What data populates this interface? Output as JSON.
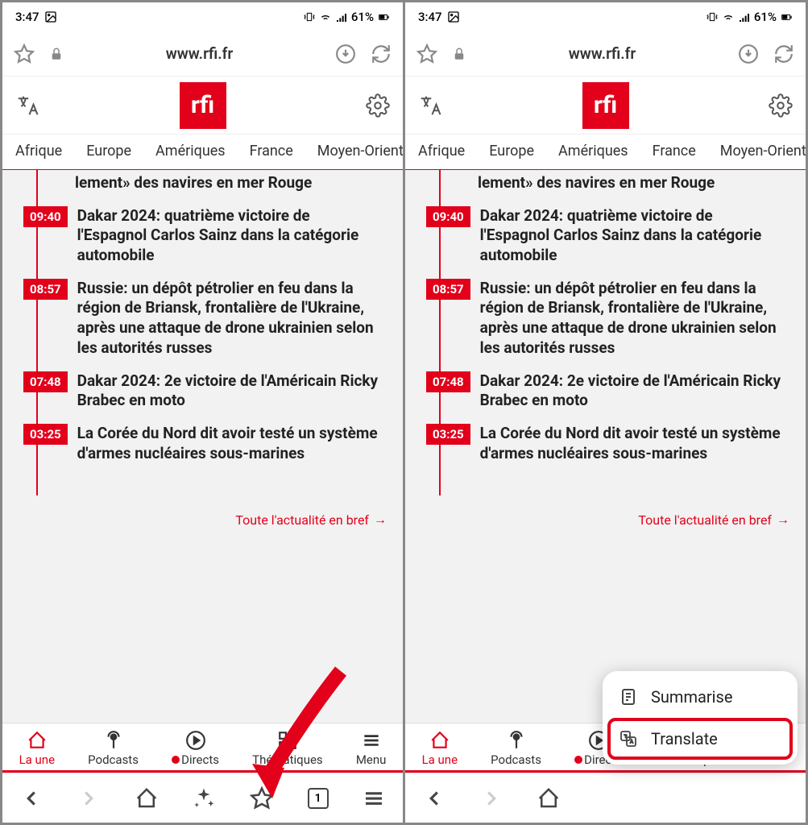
{
  "status": {
    "time": "3:47",
    "battery": "61%"
  },
  "browser": {
    "url": "www.rfi.fr",
    "tabs_count": "1"
  },
  "site": {
    "logo_text": "rfi",
    "nav_tabs": [
      "Afrique",
      "Europe",
      "Amériques",
      "France",
      "Moyen-Orient"
    ]
  },
  "news": [
    {
      "time": "",
      "headline": "lement» des navires en mer Rouge"
    },
    {
      "time": "09:40",
      "headline": "Dakar 2024: quatrième victoire de l'Espagnol Carlos Sainz dans la catégorie automobile"
    },
    {
      "time": "08:57",
      "headline": "Russie: un dépôt pétrolier en feu dans la région de Briansk, frontalière de l'Ukraine, après une attaque de drone ukrainien selon les autorités russes"
    },
    {
      "time": "07:48",
      "headline": "Dakar 2024: 2e victoire de l'Américain Ricky Brabec en moto"
    },
    {
      "time": "03:25",
      "headline": "La Corée du Nord dit avoir testé un système d'armes nucléaires sous-marines"
    }
  ],
  "all_news_link": "Toute l'actualité en bref",
  "site_nav": {
    "la_une": "La une",
    "podcasts": "Podcasts",
    "directs": "Directs",
    "thematiques": "Thématiques",
    "menu": "Menu"
  },
  "popup": {
    "summarise": "Summarise",
    "translate": "Translate"
  }
}
